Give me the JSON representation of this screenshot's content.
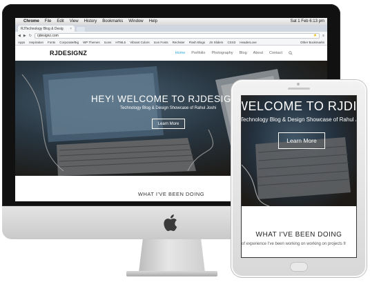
{
  "menubar": {
    "app_name": "Chrome",
    "items": [
      "File",
      "Edit",
      "View",
      "History",
      "Bookmarks",
      "Window",
      "Help"
    ],
    "clock": "Sat 1 Feb  6:13 pm"
  },
  "browser": {
    "tab_title": "RJTechnology Blog & Desig",
    "url": "rjdesignz.com",
    "bookmarks": [
      "Apps",
      "Inspiration",
      "Fonts",
      "Corporate/Big",
      "WP Themes",
      "Icons",
      "HTML5",
      "Vibrant Colors",
      "Icon Fonts",
      "Rechster",
      "Flash Blogs",
      "JS Sliders",
      "CSS3",
      "HeaderLove"
    ],
    "other_bookmarks": "Other Bookmarks"
  },
  "site": {
    "logo": "RJDESIGNZ",
    "nav": [
      "Home",
      "Portfolio",
      "Photography",
      "Blog",
      "About",
      "Contact"
    ],
    "hero_title": "HEY! WELCOME TO RJDESIGNZ",
    "hero_subtitle": "Technology Blog & Design Showcase of Rahul Joshi",
    "cta_label": "Learn More",
    "section_title": "WHAT I'VE BEEN DOING"
  },
  "phone": {
    "hero_title": "WELCOME TO RJDI",
    "hero_subtitle": "Technology Blog & Design Showcase of Rahul Joshi",
    "cta_label": "Learn More",
    "section_title": "WHAT I'VE BEEN DOING",
    "section_body": "of experience I've been working on working on projects fr"
  },
  "colors": {
    "accent": "#2fa8e0",
    "bezel": "#111111"
  },
  "icons": [
    "apple-logo-icon",
    "search-icon",
    "star-icon",
    "close-icon"
  ]
}
